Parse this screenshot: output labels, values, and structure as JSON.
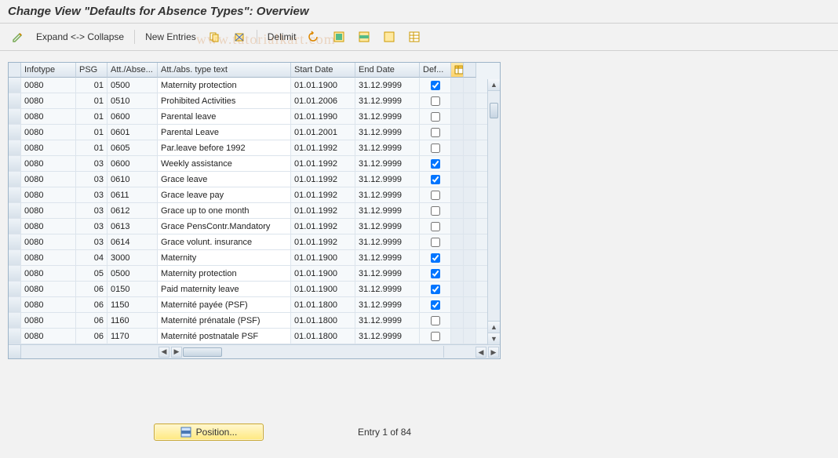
{
  "title": "Change View \"Defaults for Absence Types\": Overview",
  "toolbar": {
    "expand_collapse": "Expand <-> Collapse",
    "new_entries": "New Entries",
    "delimit": "Delimit"
  },
  "icons": {
    "pencil": "toggle-change-mode-icon",
    "copy": "copy-as-icon",
    "delete": "delete-icon",
    "undo": "undo-icon",
    "select_all": "select-all-icon",
    "select_block": "select-block-icon",
    "deselect": "deselect-all-icon",
    "config": "table-settings-icon",
    "position": "position-icon"
  },
  "columns": {
    "infotype": "Infotype",
    "psg": "PSG",
    "attabse": "Att./Abse...",
    "text": "Att./abs. type text",
    "start": "Start Date",
    "end": "End Date",
    "def": "Def..."
  },
  "rows": [
    {
      "infotype": "0080",
      "psg": "01",
      "att": "0500",
      "text": "Maternity protection",
      "start": "01.01.1900",
      "end": "31.12.9999",
      "def": true
    },
    {
      "infotype": "0080",
      "psg": "01",
      "att": "0510",
      "text": "Prohibited Activities",
      "start": "01.01.2006",
      "end": "31.12.9999",
      "def": false
    },
    {
      "infotype": "0080",
      "psg": "01",
      "att": "0600",
      "text": "Parental leave",
      "start": "01.01.1990",
      "end": "31.12.9999",
      "def": false
    },
    {
      "infotype": "0080",
      "psg": "01",
      "att": "0601",
      "text": "Parental Leave",
      "start": "01.01.2001",
      "end": "31.12.9999",
      "def": false
    },
    {
      "infotype": "0080",
      "psg": "01",
      "att": "0605",
      "text": "Par.leave before 1992",
      "start": "01.01.1992",
      "end": "31.12.9999",
      "def": false
    },
    {
      "infotype": "0080",
      "psg": "03",
      "att": "0600",
      "text": "Weekly assistance",
      "start": "01.01.1992",
      "end": "31.12.9999",
      "def": true
    },
    {
      "infotype": "0080",
      "psg": "03",
      "att": "0610",
      "text": "Grace leave",
      "start": "01.01.1992",
      "end": "31.12.9999",
      "def": true
    },
    {
      "infotype": "0080",
      "psg": "03",
      "att": "0611",
      "text": "Grace leave pay",
      "start": "01.01.1992",
      "end": "31.12.9999",
      "def": false
    },
    {
      "infotype": "0080",
      "psg": "03",
      "att": "0612",
      "text": "Grace up to one month",
      "start": "01.01.1992",
      "end": "31.12.9999",
      "def": false
    },
    {
      "infotype": "0080",
      "psg": "03",
      "att": "0613",
      "text": "Grace PensContr.Mandatory",
      "start": "01.01.1992",
      "end": "31.12.9999",
      "def": false
    },
    {
      "infotype": "0080",
      "psg": "03",
      "att": "0614",
      "text": "Grace volunt. insurance",
      "start": "01.01.1992",
      "end": "31.12.9999",
      "def": false
    },
    {
      "infotype": "0080",
      "psg": "04",
      "att": "3000",
      "text": "Maternity",
      "start": "01.01.1900",
      "end": "31.12.9999",
      "def": true
    },
    {
      "infotype": "0080",
      "psg": "05",
      "att": "0500",
      "text": "Maternity protection",
      "start": "01.01.1900",
      "end": "31.12.9999",
      "def": true
    },
    {
      "infotype": "0080",
      "psg": "06",
      "att": "0150",
      "text": "Paid maternity leave",
      "start": "01.01.1900",
      "end": "31.12.9999",
      "def": true
    },
    {
      "infotype": "0080",
      "psg": "06",
      "att": "1150",
      "text": "Maternité payée (PSF)",
      "start": "01.01.1800",
      "end": "31.12.9999",
      "def": true
    },
    {
      "infotype": "0080",
      "psg": "06",
      "att": "1160",
      "text": "Maternité prénatale (PSF)",
      "start": "01.01.1800",
      "end": "31.12.9999",
      "def": false
    },
    {
      "infotype": "0080",
      "psg": "06",
      "att": "1170",
      "text": "Maternité postnatale PSF",
      "start": "01.01.1800",
      "end": "31.12.9999",
      "def": false
    }
  ],
  "footer": {
    "position_label": "Position...",
    "entry_text": "Entry 1 of 84"
  },
  "watermark": "www.tutorialkart.com"
}
